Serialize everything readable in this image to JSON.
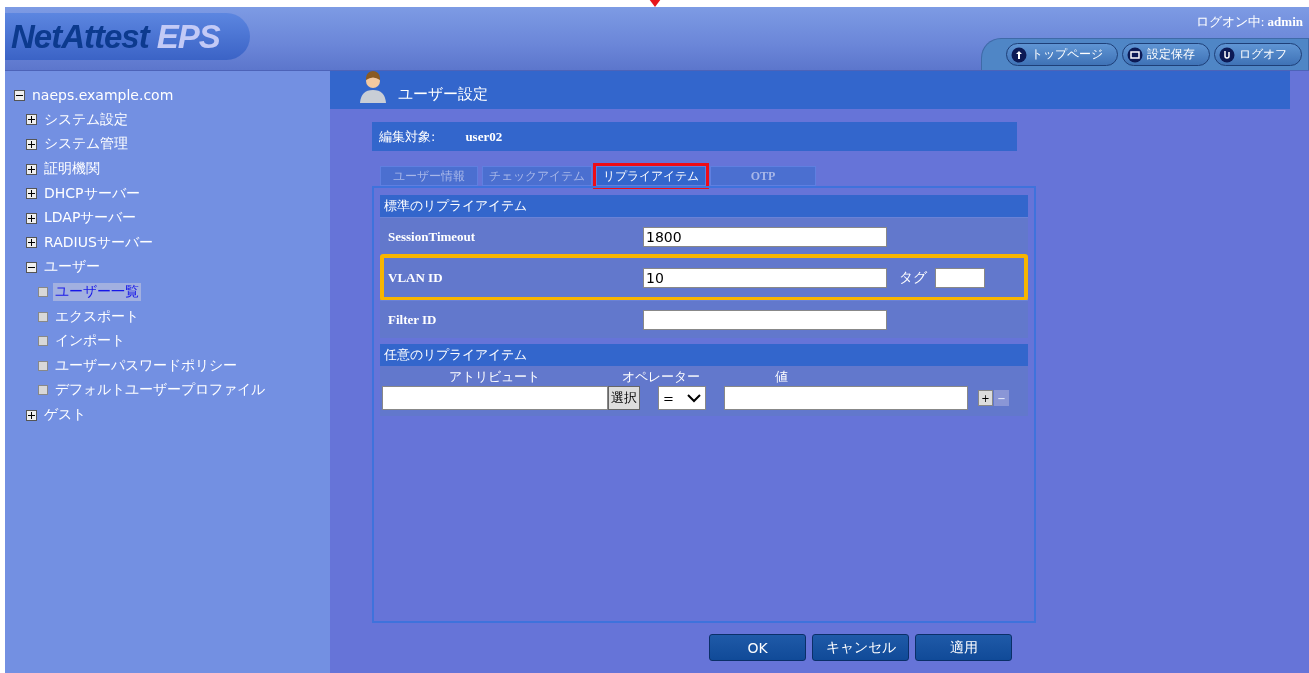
{
  "header": {
    "logo_main": "NetAttest",
    "logo_sub": "EPS",
    "logon_label": "ログオン中:",
    "logon_user": "admin",
    "nav_buttons": [
      {
        "label": "トップページ",
        "kind": "up"
      },
      {
        "label": "設定保存",
        "kind": "save"
      },
      {
        "label": "ログオフ",
        "kind": "logoff"
      }
    ]
  },
  "tree": [
    {
      "label": "naeps.example.com",
      "expanded": true,
      "selected": false,
      "children": [
        {
          "label": "システム設定",
          "expanded": false,
          "selected": false
        },
        {
          "label": "システム管理",
          "expanded": false,
          "selected": false
        },
        {
          "label": "証明機関",
          "expanded": false,
          "selected": false
        },
        {
          "label": "DHCPサーバー",
          "expanded": false,
          "selected": false
        },
        {
          "label": "LDAPサーバー",
          "expanded": false,
          "selected": false
        },
        {
          "label": "RADIUSサーバー",
          "expanded": false,
          "selected": false
        },
        {
          "label": "ユーザー",
          "expanded": true,
          "selected": false,
          "children": [
            {
              "label": "ユーザー一覧",
              "selected": true
            },
            {
              "label": "エクスポート",
              "selected": false
            },
            {
              "label": "インポート",
              "selected": false
            },
            {
              "label": "ユーザーパスワードポリシー",
              "selected": false
            },
            {
              "label": "デフォルトユーザープロファイル",
              "selected": false
            }
          ]
        },
        {
          "label": "ゲスト",
          "expanded": false,
          "selected": false
        }
      ]
    }
  ],
  "page_title": "ユーザー設定",
  "edit_target": {
    "label": "編集対象:",
    "value": "user02"
  },
  "tabs": [
    {
      "label": "ユーザー情報",
      "selected": false,
      "highlighted": false
    },
    {
      "label": "チェックアイテム",
      "selected": false,
      "highlighted": false
    },
    {
      "label": "リプライアイテム",
      "selected": true,
      "highlighted": true
    },
    {
      "label": "OTP",
      "selected": false,
      "highlighted": false
    }
  ],
  "standard_section": {
    "title": "標準のリプライアイテム",
    "rows": [
      {
        "label": "SessionTimeout",
        "value": "1800",
        "highlighted": false
      },
      {
        "label": "VLAN ID",
        "value": "10",
        "tag_label": "タグ",
        "highlighted": true
      },
      {
        "label": "Filter ID",
        "highlighted": false
      }
    ]
  },
  "custom_section": {
    "title": "任意のリプライアイテム",
    "columns": [
      "アトリビュート",
      "オペレーター",
      "値"
    ],
    "select_button": "選択",
    "operator": "=",
    "add_button": "+",
    "remove_button": "−"
  },
  "buttons": [
    "OK",
    "キャンセル",
    "適用"
  ]
}
